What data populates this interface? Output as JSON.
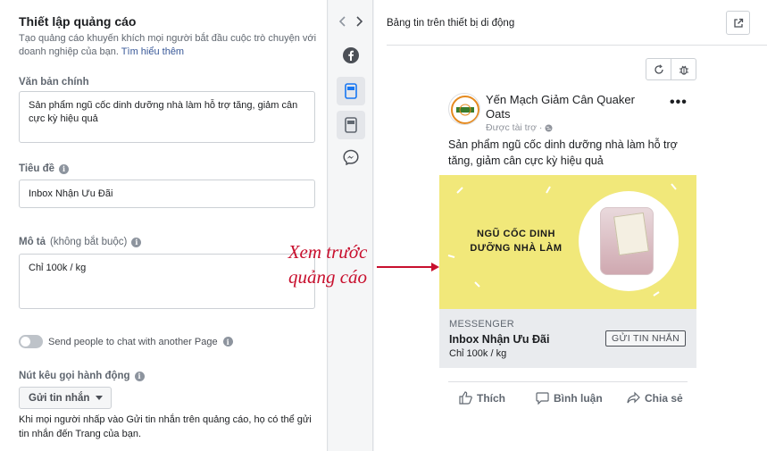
{
  "left": {
    "title": "Thiết lập quảng cáo",
    "description": "Tạo quảng cáo khuyến khích mọi người bắt đầu cuộc trò chuyện với doanh nghiệp của bạn.",
    "learn_more": "Tìm hiểu thêm",
    "primary_text_label": "Văn bản chính",
    "primary_text_value": "Sản phẩm ngũ cốc dinh dưỡng nhà làm hỗ trợ tăng, giảm cân cực kỳ hiệu quả",
    "headline_label": "Tiêu đề",
    "headline_value": "Inbox Nhận Ưu Đãi",
    "description_label": "Mô tả",
    "description_optional": "(không bắt buộc)",
    "description_value": "Chỉ 100k / kg",
    "toggle_label": "Send people to chat with another Page",
    "cta_label": "Nút kêu gọi hành động",
    "cta_value": "Gửi tin nhắn",
    "bottom_note": "Khi mọi người nhấp vào Gửi tin nhắn trên quảng cáo, họ có thể gửi tin nhắn đến Trang của bạn.",
    "info_glyph": "i"
  },
  "right": {
    "header": "Bảng tin trên thiết bị di động",
    "ad": {
      "page_name": "Yến Mạch Giảm Cân Quaker Oats",
      "sponsored": "Được tài trợ · ",
      "primary_text": "Sản phẩm ngũ cốc dinh dưỡng nhà làm hỗ trợ tăng, giảm cân cực kỳ hiệu quả",
      "image_text": "NGŨ CỐC DINH DƯỠNG NHÀ LÀM",
      "cta_top": "MESSENGER",
      "cta_headline": "Inbox Nhận Ưu Đãi",
      "cta_desc": "Chỉ 100k / kg",
      "cta_button": "GỬI TIN NHẮN",
      "actions": [
        "Thích",
        "Bình luận",
        "Chia sẻ"
      ],
      "more": "•••"
    }
  },
  "annotation": {
    "text": "Xem trước quảng cáo",
    "color": "#c8102e"
  },
  "colors": {
    "link": "#385898",
    "ad_image_bg": "#f1e87a",
    "cta_bar_bg": "#e9ebee"
  }
}
